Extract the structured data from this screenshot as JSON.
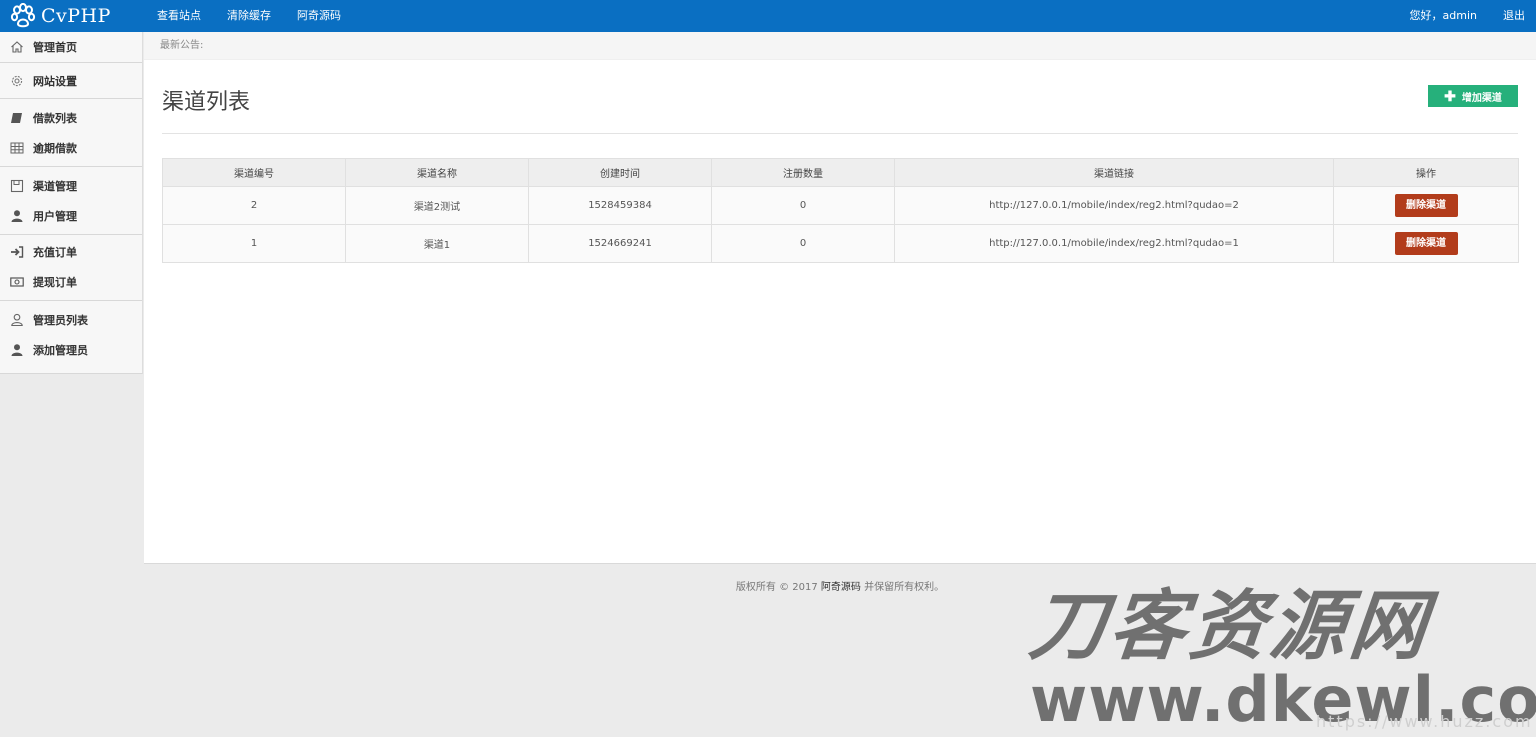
{
  "header": {
    "logo_text": "CvPHP",
    "nav": [
      "查看站点",
      "清除缓存",
      "阿奇源码"
    ],
    "greeting": "您好，admin",
    "logout": "退出"
  },
  "sidebar": {
    "groups": [
      [
        {
          "label": "管理首页",
          "icon": "home-icon"
        }
      ],
      [
        {
          "label": "网站设置",
          "icon": "gear-icon"
        }
      ],
      [
        {
          "label": "借款列表",
          "icon": "book-icon"
        },
        {
          "label": "逾期借款",
          "icon": "table-icon"
        }
      ],
      [
        {
          "label": "渠道管理",
          "icon": "save-icon"
        },
        {
          "label": "用户管理",
          "icon": "user-icon"
        }
      ],
      [
        {
          "label": "充值订单",
          "icon": "sign-in-icon"
        },
        {
          "label": "提现订单",
          "icon": "money-icon"
        }
      ],
      [
        {
          "label": "管理员列表",
          "icon": "user-outline-icon"
        },
        {
          "label": "添加管理员",
          "icon": "user-icon"
        }
      ]
    ]
  },
  "notice": {
    "label": "最新公告:"
  },
  "page": {
    "title": "渠道列表",
    "add_button": "增加渠道"
  },
  "table": {
    "headers": [
      "渠道编号",
      "渠道名称",
      "创建时间",
      "注册数量",
      "渠道链接",
      "操作"
    ],
    "rows": [
      [
        "2",
        "渠道2测试",
        "1528459384",
        "0",
        "http://127.0.0.1/mobile/index/reg2.html?qudao=2",
        "删除渠道"
      ],
      [
        "1",
        "渠道1",
        "1524669241",
        "0",
        "http://127.0.0.1/mobile/index/reg2.html?qudao=1",
        "删除渠道"
      ]
    ]
  },
  "footer": {
    "prefix": "版权所有 © 2017 ",
    "brand": "阿奇源码",
    "suffix": " 并保留所有权利。"
  },
  "watermark": {
    "cn": "刀客资源网",
    "en": "www.dkewl.com",
    "faint": "https://www.huzz.com"
  },
  "colors": {
    "topbar": "#0a6fc2",
    "add_button": "#26b07b",
    "delete_button": "#b23c1b"
  }
}
